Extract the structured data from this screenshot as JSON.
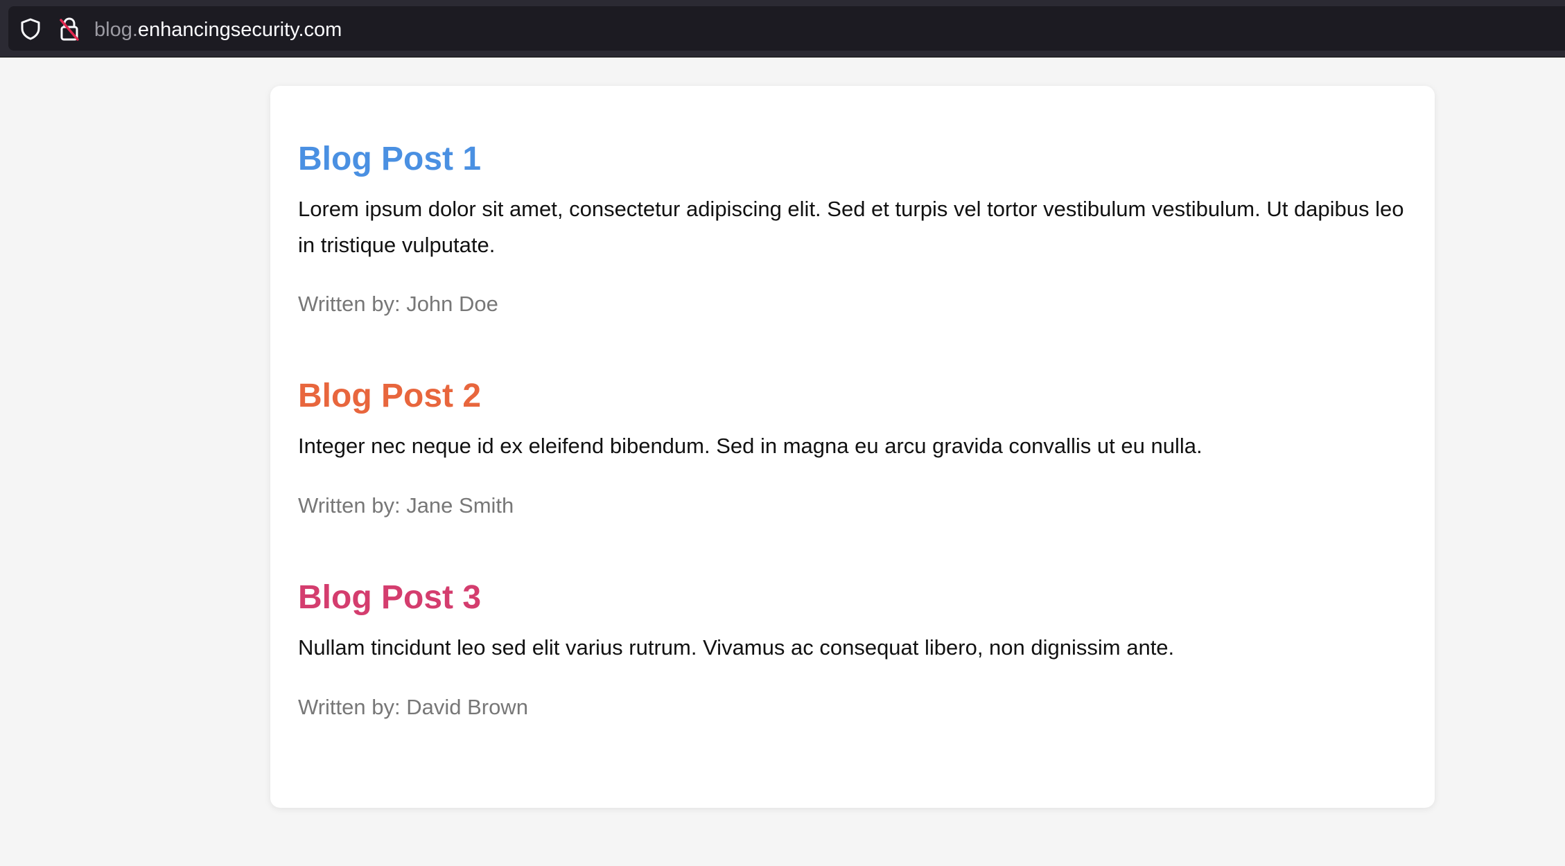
{
  "browser": {
    "url_subdomain": "blog.",
    "url_domain": "enhancingsecurity.com",
    "icons": [
      "shield-icon",
      "insecure-lock-icon"
    ]
  },
  "posts": [
    {
      "title": "Blog Post 1",
      "title_color": "#4a90e2",
      "body": "Lorem ipsum dolor sit amet, consectetur adipiscing elit. Sed et turpis vel tortor vestibulum vestibulum. Ut dapibus leo in tristique vulputate.",
      "author": "Written by: John Doe"
    },
    {
      "title": "Blog Post 2",
      "title_color": "#e8663d",
      "body": "Integer nec neque id ex eleifend bibendum. Sed in magna eu arcu gravida convallis ut eu nulla.",
      "author": "Written by: Jane Smith"
    },
    {
      "title": "Blog Post 3",
      "title_color": "#d43d6e",
      "body": "Nullam tincidunt leo sed elit varius rutrum. Vivamus ac consequat libero, non dignissim ante.",
      "author": "Written by: David Brown"
    }
  ]
}
